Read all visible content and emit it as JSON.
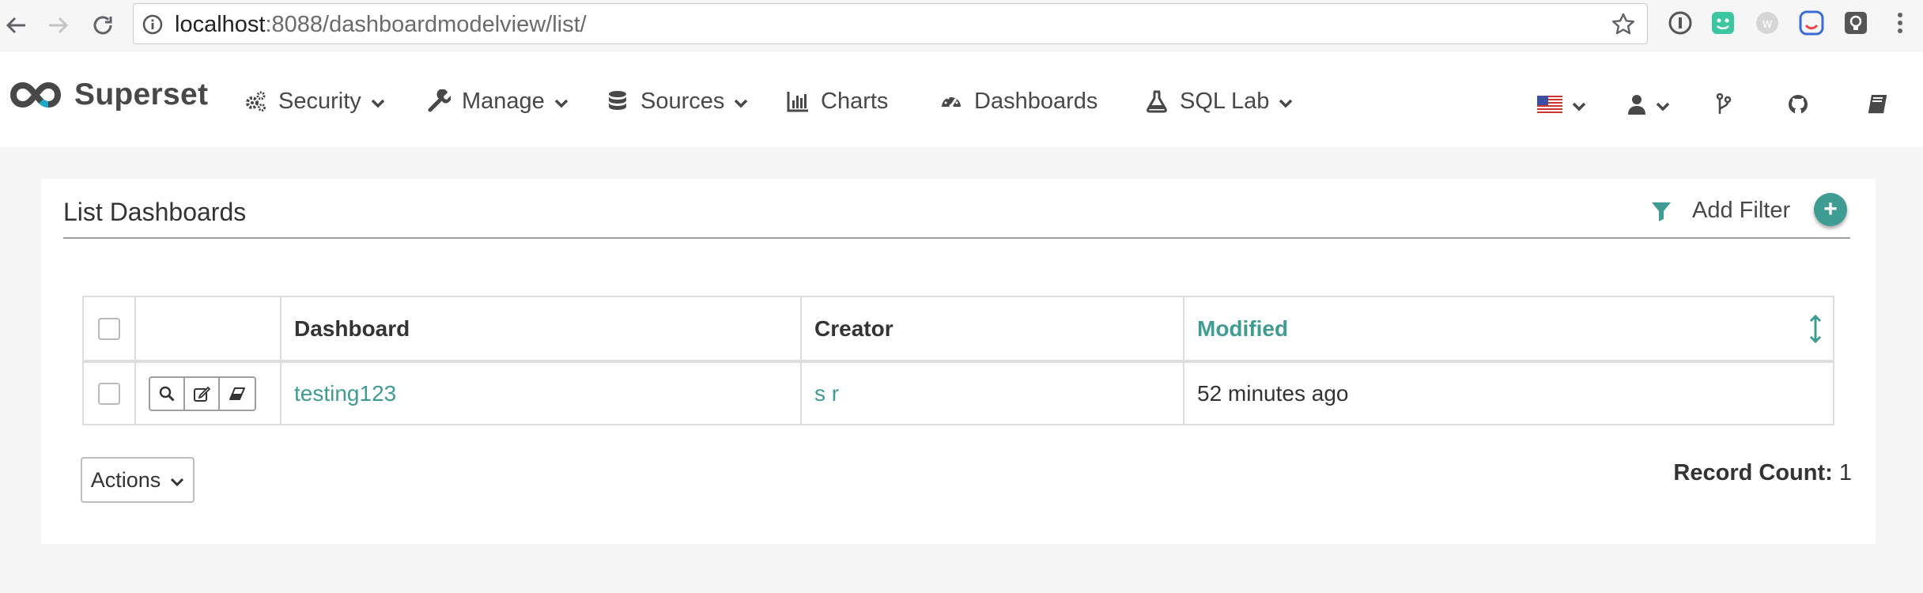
{
  "browser": {
    "url_host": "localhost",
    "url_path": ":8088/dashboardmodelview/list/"
  },
  "brand": {
    "name": "Superset"
  },
  "menu": [
    {
      "label": "Security",
      "icon": "cogs-icon",
      "dropdown": true
    },
    {
      "label": "Manage",
      "icon": "wrench-icon",
      "dropdown": true
    },
    {
      "label": "Sources",
      "icon": "database-icon",
      "dropdown": true
    },
    {
      "label": "Charts",
      "icon": "bar-chart-icon",
      "dropdown": false
    },
    {
      "label": "Dashboards",
      "icon": "dashboard-icon",
      "dropdown": false
    },
    {
      "label": "SQL Lab",
      "icon": "flask-icon",
      "dropdown": true
    }
  ],
  "right_nav": [
    "us-flag-icon",
    "user-icon",
    "code-branch-icon",
    "github-icon",
    "book-icon"
  ],
  "panel": {
    "title": "List Dashboards",
    "add_filter_label": "Add Filter",
    "plus_label": "+"
  },
  "table": {
    "columns": [
      "Dashboard",
      "Creator",
      "Modified"
    ],
    "sorted_column": "Modified",
    "rows": [
      {
        "dashboard": "testing123",
        "creator": "s r",
        "modified": "52 minutes ago"
      }
    ]
  },
  "footer": {
    "actions_label": "Actions",
    "record_count_label": "Record Count:",
    "record_count_value": "1"
  },
  "colors": {
    "accent": "#3f9c92",
    "text": "#484848",
    "background": "#f5f5f5"
  }
}
